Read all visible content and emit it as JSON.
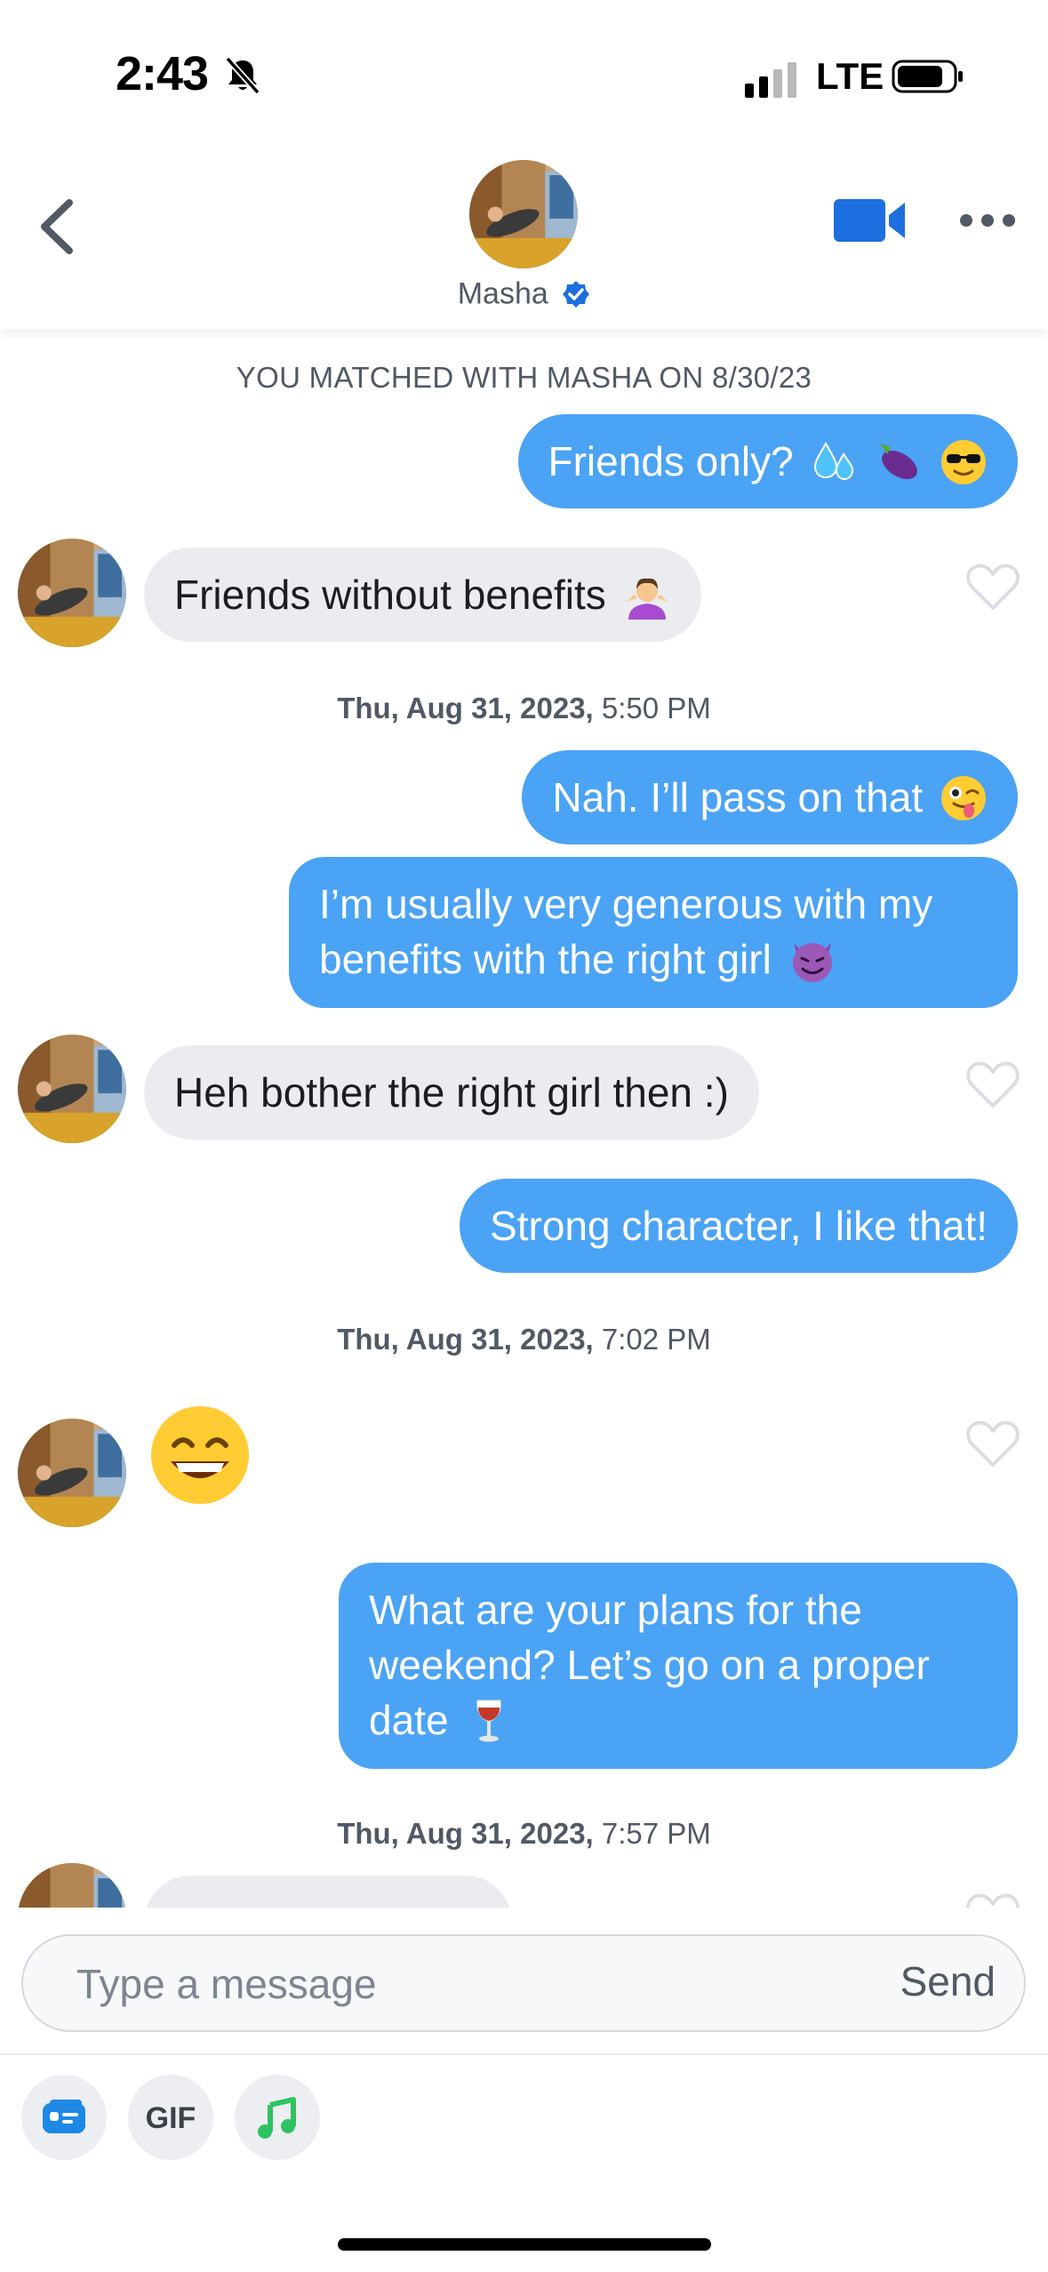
{
  "status_bar": {
    "time": "2:43",
    "network": "LTE",
    "bell_icon": "bell-slash-icon",
    "signal_icon": "cellular-signal-icon",
    "battery_icon": "battery-icon"
  },
  "header": {
    "back_icon": "chevron-left-icon",
    "name": "Masha",
    "verified_icon": "verified-badge-icon",
    "video_icon": "video-camera-icon",
    "more_icon": "more-dots-icon"
  },
  "chat": {
    "match_notice": "YOU MATCHED WITH MASHA ON 8/30/23",
    "timestamps": [
      {
        "date": "Thu, Aug 31, 2023,",
        "time": " 5:50 PM"
      },
      {
        "date": "Thu, Aug 31, 2023,",
        "time": " 7:02 PM"
      },
      {
        "date": "Thu, Aug 31, 2023,",
        "time": " 7:57 PM"
      }
    ],
    "messages": [
      {
        "sender": "me",
        "text": "Friends only?",
        "emojis": [
          "sweat-droplets-emoji",
          "eggplant-emoji",
          "sunglasses-face-emoji"
        ]
      },
      {
        "sender": "match",
        "text": "Friends without benefits",
        "emojis": [
          "person-shrugging-emoji"
        ]
      },
      {
        "sender": "me",
        "text": "Nah. I’ll pass on that",
        "emojis": [
          "winking-tongue-face-emoji"
        ]
      },
      {
        "sender": "me",
        "text": "I’m usually very generous with my benefits with the right girl",
        "emojis": [
          "smiling-devil-emoji"
        ]
      },
      {
        "sender": "match",
        "text": "Heh bother the right girl then :)",
        "emojis": []
      },
      {
        "sender": "me",
        "text": "Strong character, I like that!",
        "emojis": []
      },
      {
        "sender": "match",
        "text": "",
        "emojis": [
          "grinning-smiling-eyes-emoji"
        ]
      },
      {
        "sender": "me",
        "text": "What are your plans for the weekend? Let’s go on a proper date",
        "emojis": [
          "wine-glass-emoji"
        ]
      }
    ],
    "like_icon": "heart-outline-icon"
  },
  "composer": {
    "placeholder": "Type a message",
    "send_label": "Send",
    "tools": [
      {
        "icon": "sticker-card-icon"
      },
      {
        "label": "GIF"
      },
      {
        "icon": "music-note-icon"
      }
    ]
  },
  "colors": {
    "outgoing_bubble": "#4ba3f5",
    "incoming_bubble": "#ebecf0",
    "accent_blue": "#1d6fe0",
    "music_green": "#2ec361"
  }
}
